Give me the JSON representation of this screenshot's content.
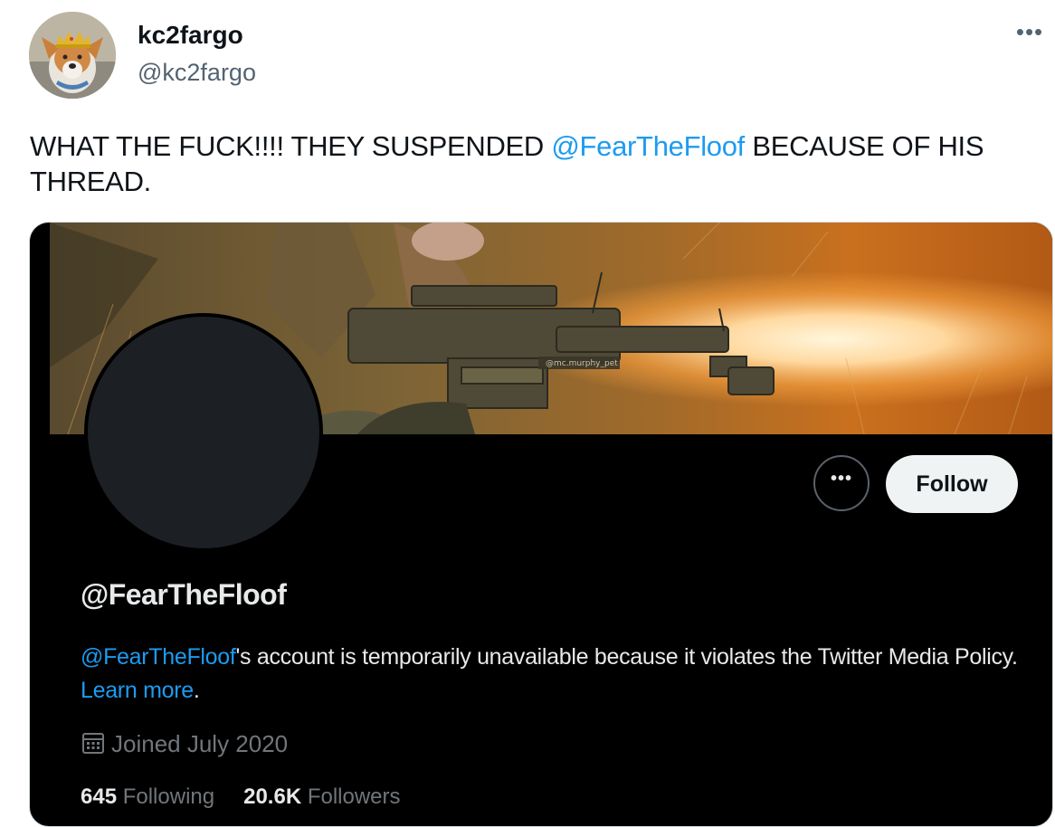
{
  "author": {
    "name": "kc2fargo",
    "handle": "@kc2fargo"
  },
  "more_menu_icon": "ellipsis-icon",
  "tweet": {
    "text_before": "WHAT THE FUCK!!!! THEY SUSPENDED ",
    "mention": "@FearTheFloof",
    "text_after": "  BECAUSE OF HIS THREAD."
  },
  "media": {
    "banner_watermark": "@mc.murphy_pet",
    "profile_more_icon": "ellipsis-icon",
    "follow_label": "Follow",
    "profile_handle": "@FearTheFloof",
    "notice": {
      "mention": "@FearTheFloof",
      "text": "'s account is temporarily unavailable because it violates the Twitter Media Policy. ",
      "link": "Learn more",
      "end": "."
    },
    "joined": {
      "icon": "calendar-icon",
      "text": "Joined July 2020"
    },
    "stats": {
      "following_count": "645",
      "following_label": "Following",
      "followers_count": "20.6K",
      "followers_label": "Followers"
    }
  },
  "colors": {
    "link": "#1d9bf0",
    "card_background": "#000000",
    "follow_button": "#eff3f4"
  }
}
